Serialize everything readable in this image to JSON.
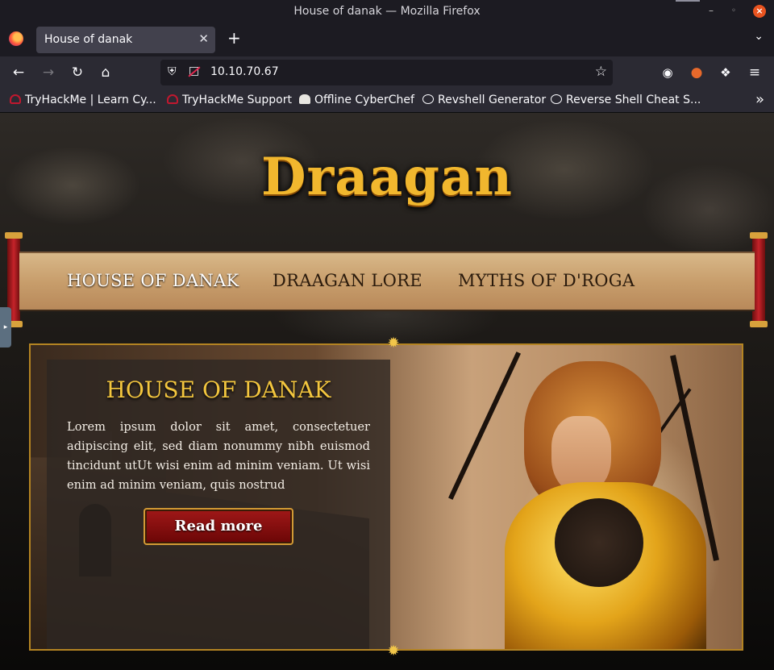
{
  "window": {
    "title": "House of danak — Mozilla Firefox"
  },
  "tabs": [
    {
      "label": "House of danak"
    }
  ],
  "navbar": {
    "url": "10.10.70.67"
  },
  "bookmarks": [
    {
      "label": "TryHackMe | Learn Cy...",
      "icon": "tryhackme-icon"
    },
    {
      "label": "TryHackMe Support",
      "icon": "tryhackme-icon"
    },
    {
      "label": "Offline CyberChef",
      "icon": "chef-hat-icon"
    },
    {
      "label": "Revshell Generator",
      "icon": "globe-icon"
    },
    {
      "label": "Reverse Shell Cheat S...",
      "icon": "globe-icon"
    }
  ],
  "site": {
    "logo": "Draagan",
    "nav": [
      "HOUSE OF DANAK",
      "DRAAGAN LORE",
      "MYTHS OF D'ROGA"
    ],
    "active_nav": "HOUSE OF DANAK"
  },
  "hero": {
    "title": "HOUSE OF DANAK",
    "body": "Lorem ipsum dolor sit amet, consectetuer adipiscing elit, sed diam nonummy nibh euismod tincidunt utUt wisi enim ad minim veniam. Ut wisi enim ad minim veniam, quis nostrud",
    "button": "Read more"
  },
  "colors": {
    "accent_gold": "#f3c63e",
    "button_red": "#a01818",
    "chrome_dark": "#1c1b22",
    "chrome_toolbar": "#2b2a33"
  }
}
